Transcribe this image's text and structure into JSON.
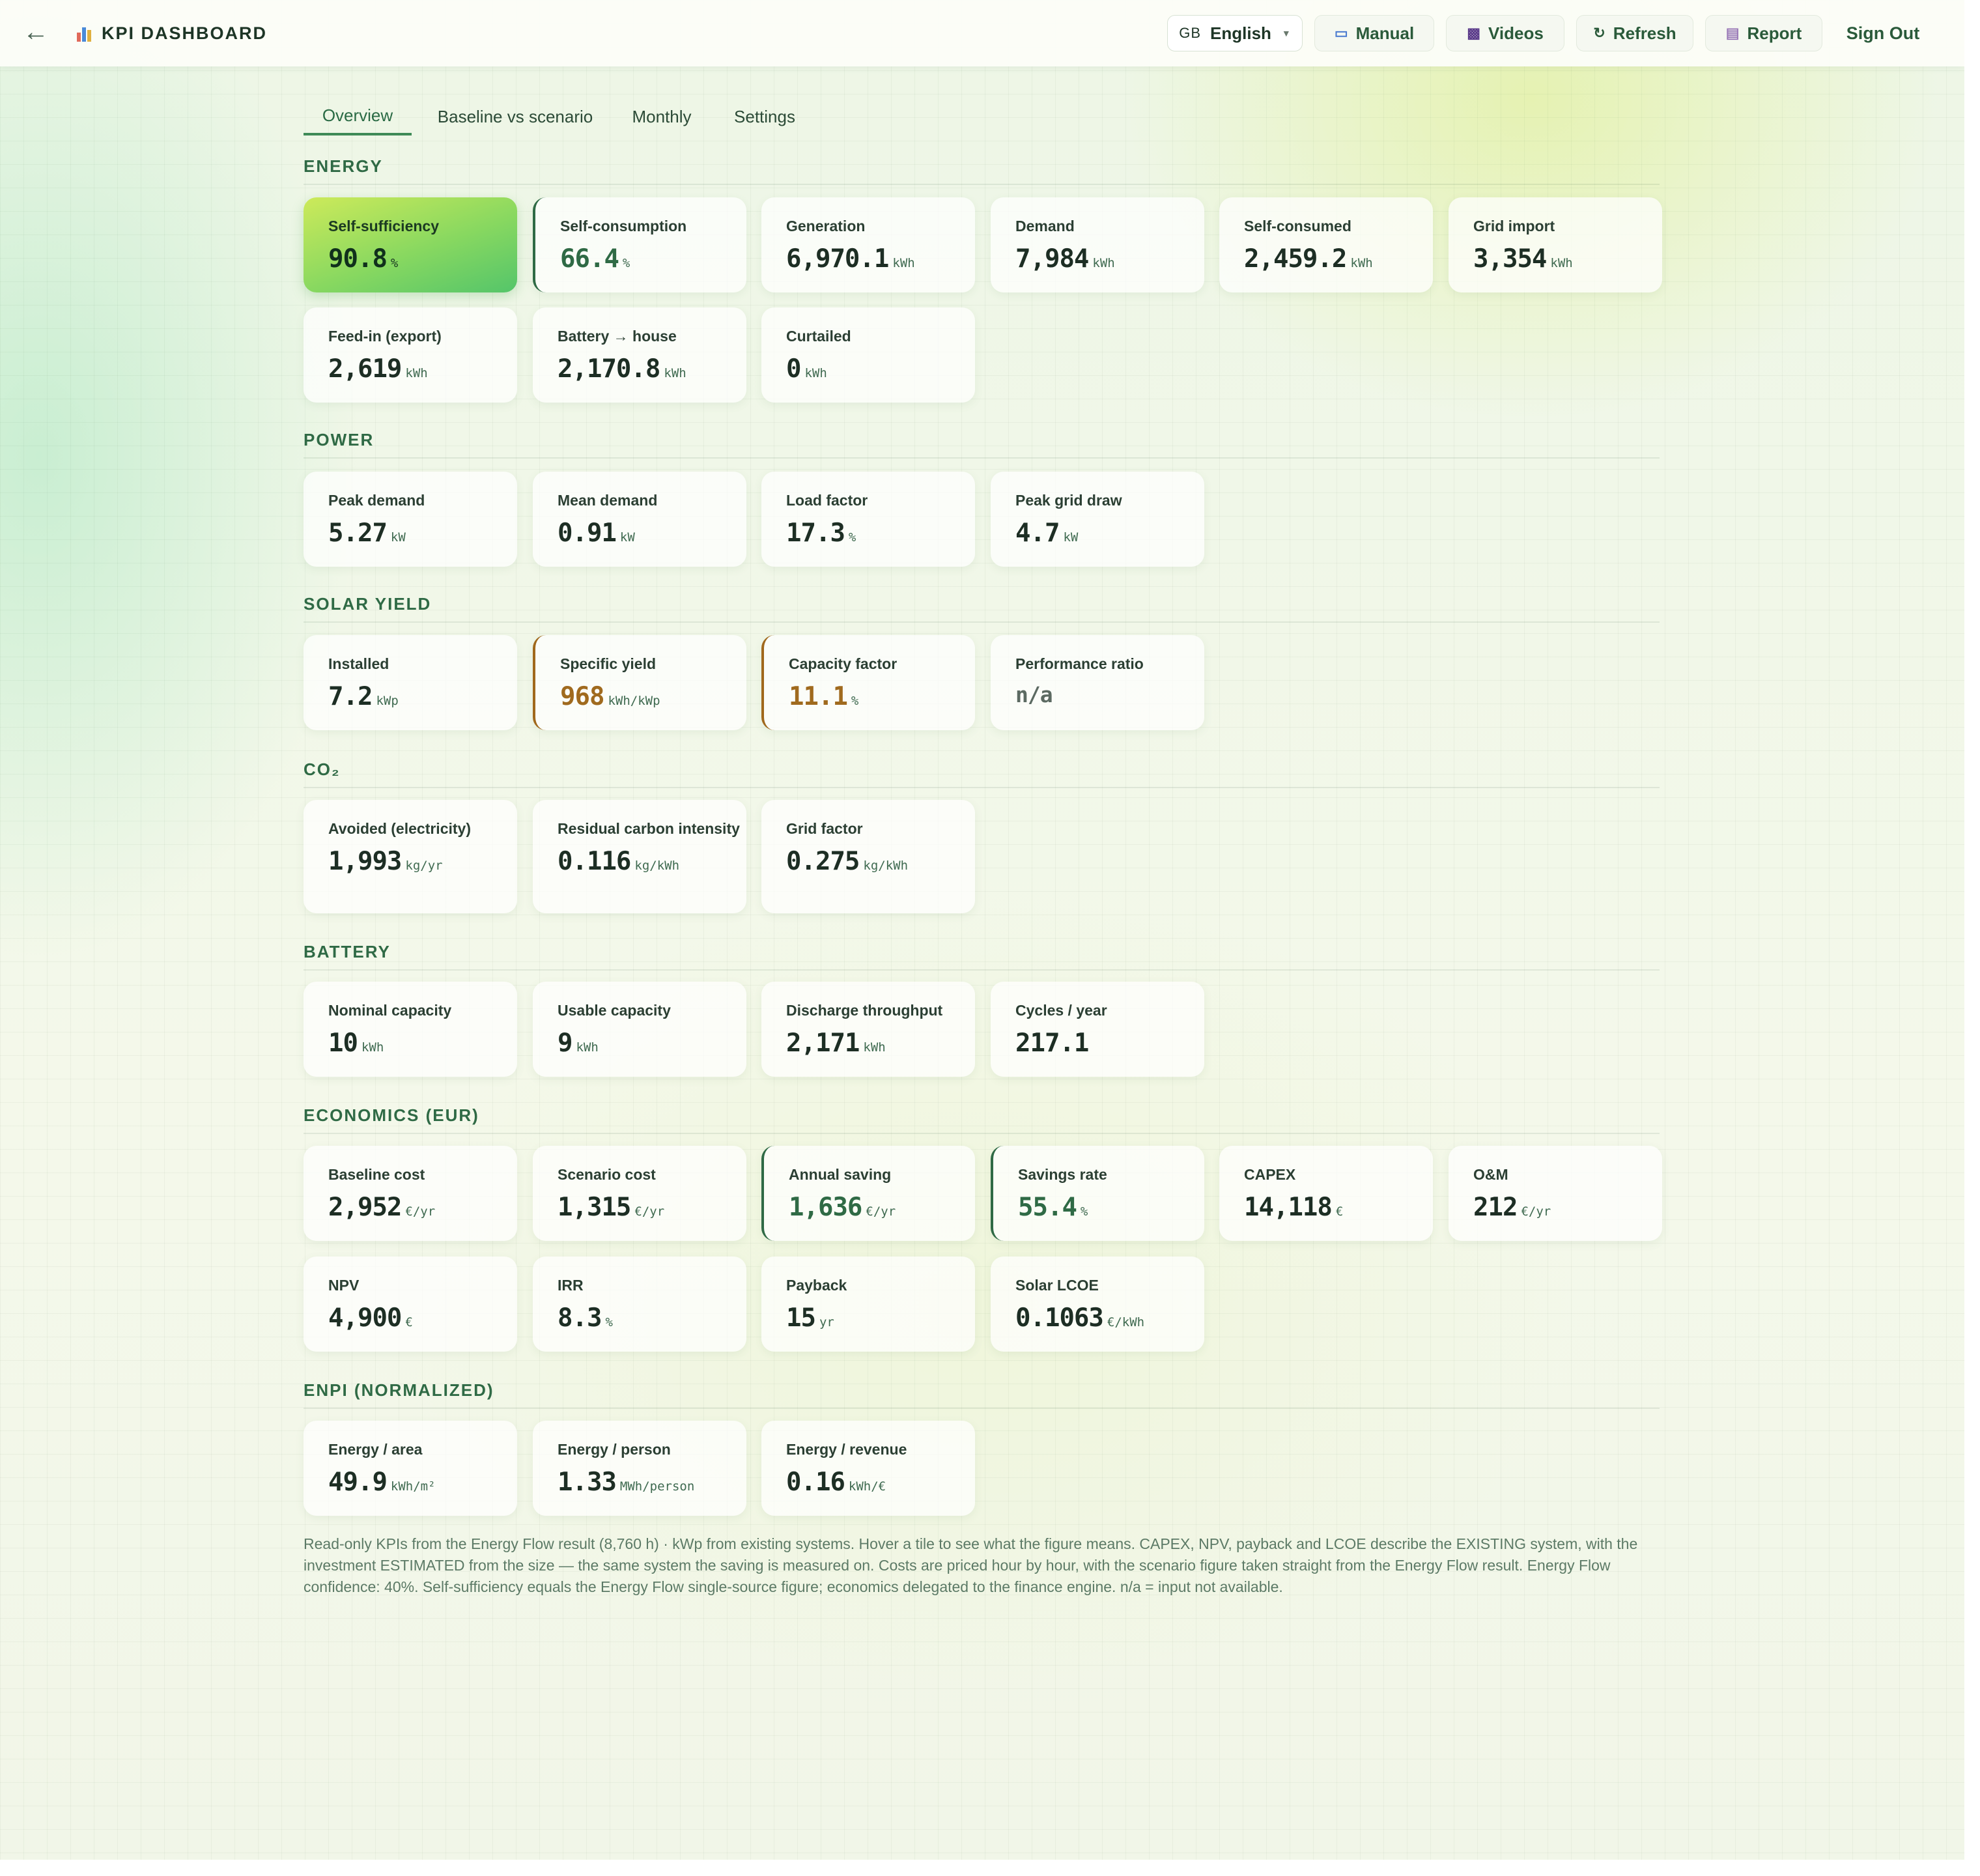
{
  "header": {
    "title": "KPI DASHBOARD",
    "language": {
      "flag": "GB",
      "label": "English"
    },
    "buttons": {
      "manual": "Manual",
      "videos": "Videos",
      "refresh": "Refresh",
      "report": "Report",
      "sign_out": "Sign Out"
    }
  },
  "tabs": [
    "Overview",
    "Baseline vs scenario",
    "Monthly",
    "Settings"
  ],
  "active_tab": "Overview",
  "colors": {
    "accent_green": "#2f6a45",
    "accent_bronze": "#a06a1e",
    "hero_gradient_start": "#cdea5a",
    "hero_gradient_end": "#54c56a"
  },
  "sections": [
    {
      "title": "ENERGY",
      "cards": [
        {
          "label": "Self-sufficiency",
          "value": "90.8",
          "unit": "%",
          "style": "hero"
        },
        {
          "label": "Self-consumption",
          "value": "66.4",
          "unit": "%",
          "style": "green"
        },
        {
          "label": "Generation",
          "value": "6,970.1",
          "unit": "kWh"
        },
        {
          "label": "Demand",
          "value": "7,984",
          "unit": "kWh"
        },
        {
          "label": "Self-consumed",
          "value": "2,459.2",
          "unit": "kWh"
        },
        {
          "label": "Grid import",
          "value": "3,354",
          "unit": "kWh"
        },
        {
          "label": "Feed-in (export)",
          "value": "2,619",
          "unit": "kWh"
        },
        {
          "label": "Battery → house",
          "value": "2,170.8",
          "unit": "kWh"
        },
        {
          "label": "Curtailed",
          "value": "0",
          "unit": "kWh"
        }
      ]
    },
    {
      "title": "POWER",
      "cards": [
        {
          "label": "Peak demand",
          "value": "5.27",
          "unit": "kW"
        },
        {
          "label": "Mean demand",
          "value": "0.91",
          "unit": "kW"
        },
        {
          "label": "Load factor",
          "value": "17.3",
          "unit": "%"
        },
        {
          "label": "Peak grid draw",
          "value": "4.7",
          "unit": "kW"
        }
      ]
    },
    {
      "title": "SOLAR YIELD",
      "cards": [
        {
          "label": "Installed",
          "value": "7.2",
          "unit": "kWp"
        },
        {
          "label": "Specific yield",
          "value": "968",
          "unit": "kWh/kWp",
          "style": "bronze"
        },
        {
          "label": "Capacity factor",
          "value": "11.1",
          "unit": "%",
          "style": "bronze"
        },
        {
          "label": "Performance ratio",
          "value": "n/a",
          "unit": "",
          "style": "muted"
        }
      ]
    },
    {
      "title": "CO₂",
      "cards": [
        {
          "label": "Avoided (electricity)",
          "value": "1,993",
          "unit": "kg/yr"
        },
        {
          "label": "Residual carbon intensity",
          "value": "0.116",
          "unit": "kg/kWh"
        },
        {
          "label": "Grid factor",
          "value": "0.275",
          "unit": "kg/kWh"
        }
      ]
    },
    {
      "title": "BATTERY",
      "cards": [
        {
          "label": "Nominal capacity",
          "value": "10",
          "unit": "kWh"
        },
        {
          "label": "Usable capacity",
          "value": "9",
          "unit": "kWh"
        },
        {
          "label": "Discharge throughput",
          "value": "2,171",
          "unit": "kWh"
        },
        {
          "label": "Cycles / year",
          "value": "217.1",
          "unit": ""
        }
      ]
    },
    {
      "title": "ECONOMICS (EUR)",
      "cards": [
        {
          "label": "Baseline cost",
          "value": "2,952",
          "unit": "€/yr"
        },
        {
          "label": "Scenario cost",
          "value": "1,315",
          "unit": "€/yr"
        },
        {
          "label": "Annual saving",
          "value": "1,636",
          "unit": "€/yr",
          "style": "green"
        },
        {
          "label": "Savings rate",
          "value": "55.4",
          "unit": "%",
          "style": "green"
        },
        {
          "label": "CAPEX",
          "value": "14,118",
          "unit": "€"
        },
        {
          "label": "O&M",
          "value": "212",
          "unit": "€/yr"
        },
        {
          "label": "NPV",
          "value": "4,900",
          "unit": "€"
        },
        {
          "label": "IRR",
          "value": "8.3",
          "unit": "%"
        },
        {
          "label": "Payback",
          "value": "15",
          "unit": "yr"
        },
        {
          "label": "Solar LCOE",
          "value": "0.1063",
          "unit": "€/kWh"
        }
      ]
    },
    {
      "title": "ENPI (NORMALIZED)",
      "cards": [
        {
          "label": "Energy / area",
          "value": "49.9",
          "unit": "kWh/m²"
        },
        {
          "label": "Energy / person",
          "value": "1.33",
          "unit": "MWh/person"
        },
        {
          "label": "Energy / revenue",
          "value": "0.16",
          "unit": "kWh/€"
        }
      ]
    }
  ],
  "footnote": "Read-only KPIs from the Energy Flow result (8,760 h) · kWp from existing systems. Hover a tile to see what the figure means. CAPEX, NPV, payback and LCOE describe the EXISTING system, with the investment ESTIMATED from the size — the same system the saving is measured on. Costs are priced hour by hour, with the scenario figure taken straight from the Energy Flow result. Energy Flow confidence: 40%. Self-sufficiency equals the Energy Flow single-source figure; economics delegated to the finance engine. n/a = input not available."
}
